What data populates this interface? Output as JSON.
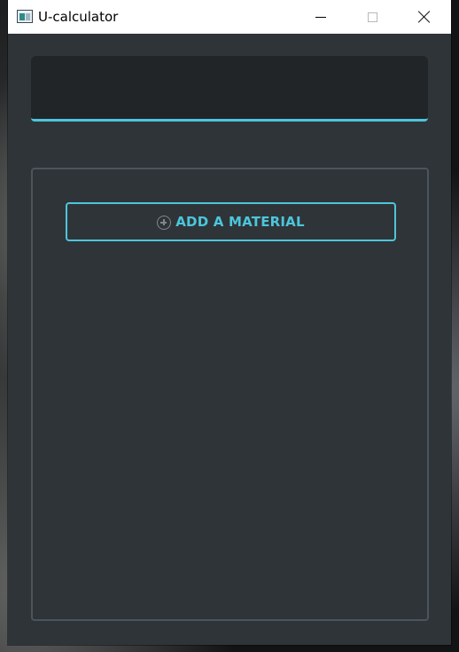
{
  "window": {
    "title": "U-calculator"
  },
  "icons": {
    "app": "app-window-icon",
    "minimize": "minimize-icon",
    "maximize": "maximize-icon",
    "close": "close-icon",
    "add": "plus-circle-icon"
  },
  "top_field": {
    "value": "",
    "placeholder": ""
  },
  "materials": {
    "add_button_label": "ADD A MATERIAL",
    "items": []
  },
  "colors": {
    "accent": "#4cc6dc",
    "window_background": "#2f3438",
    "field_background": "#222528",
    "panel_border": "#4c555c",
    "titlebar_background": "#ffffff"
  }
}
